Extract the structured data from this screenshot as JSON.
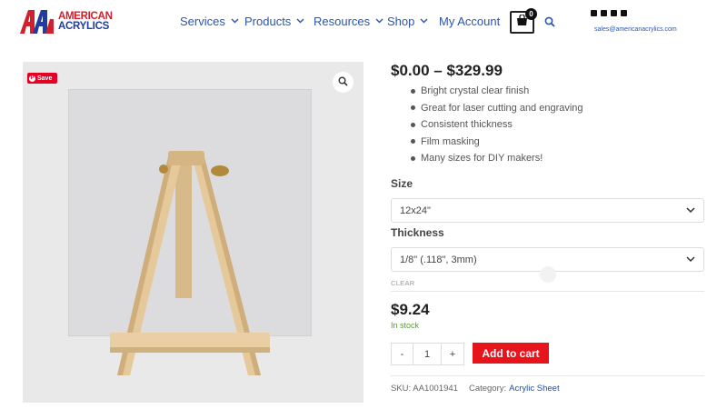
{
  "brand": {
    "line1": "AMERICAN",
    "line2": "ACRYLICS",
    "colors": {
      "red": "#d0202e",
      "blue": "#1f3c9e"
    }
  },
  "nav": {
    "items": [
      {
        "label": "Services",
        "has_dropdown": true
      },
      {
        "label": "Products",
        "has_dropdown": true
      },
      {
        "label": "Resources",
        "has_dropdown": true
      },
      {
        "label": "Shop",
        "has_dropdown": true
      },
      {
        "label": "My Account",
        "has_dropdown": false
      }
    ],
    "chevron": "⌄"
  },
  "cart": {
    "count": "0",
    "icon": "shopping-bag-icon"
  },
  "search": {
    "icon": "search-icon"
  },
  "social": {
    "icons": [
      "linkedin-icon",
      "facebook-icon",
      "instagram-icon",
      "twitter-icon"
    ]
  },
  "contact": {
    "email": "sales@americanacrylics.com"
  },
  "image": {
    "save_label": "Save",
    "pin_glyph": "P",
    "zoom_icon": "magnifier-icon"
  },
  "product": {
    "price_range": "$0.00 – $329.99",
    "features": [
      "Bright crystal clear finish",
      "Great for laser cutting and engraving",
      "Consistent thickness",
      "Film masking",
      "Many sizes for DIY makers!"
    ],
    "size_label": "Size",
    "size_value": "12x24\"",
    "thickness_label": "Thickness",
    "thickness_value": "1/8\" (.118\", 3mm)",
    "clear_label": "CLEAR",
    "price": "$9.24",
    "stock": "In stock",
    "qty_minus": "-",
    "qty_value": "1",
    "qty_plus": "+",
    "add_to_cart": "Add to cart",
    "sku": "SKU: AA1001941",
    "category_label": "Category:",
    "category_value": "Acrylic Sheet"
  },
  "colors": {
    "link": "#2a55b0",
    "cart_button": "#e8141c",
    "in_stock": "#5b9b3a",
    "pinterest": "#e60023"
  }
}
